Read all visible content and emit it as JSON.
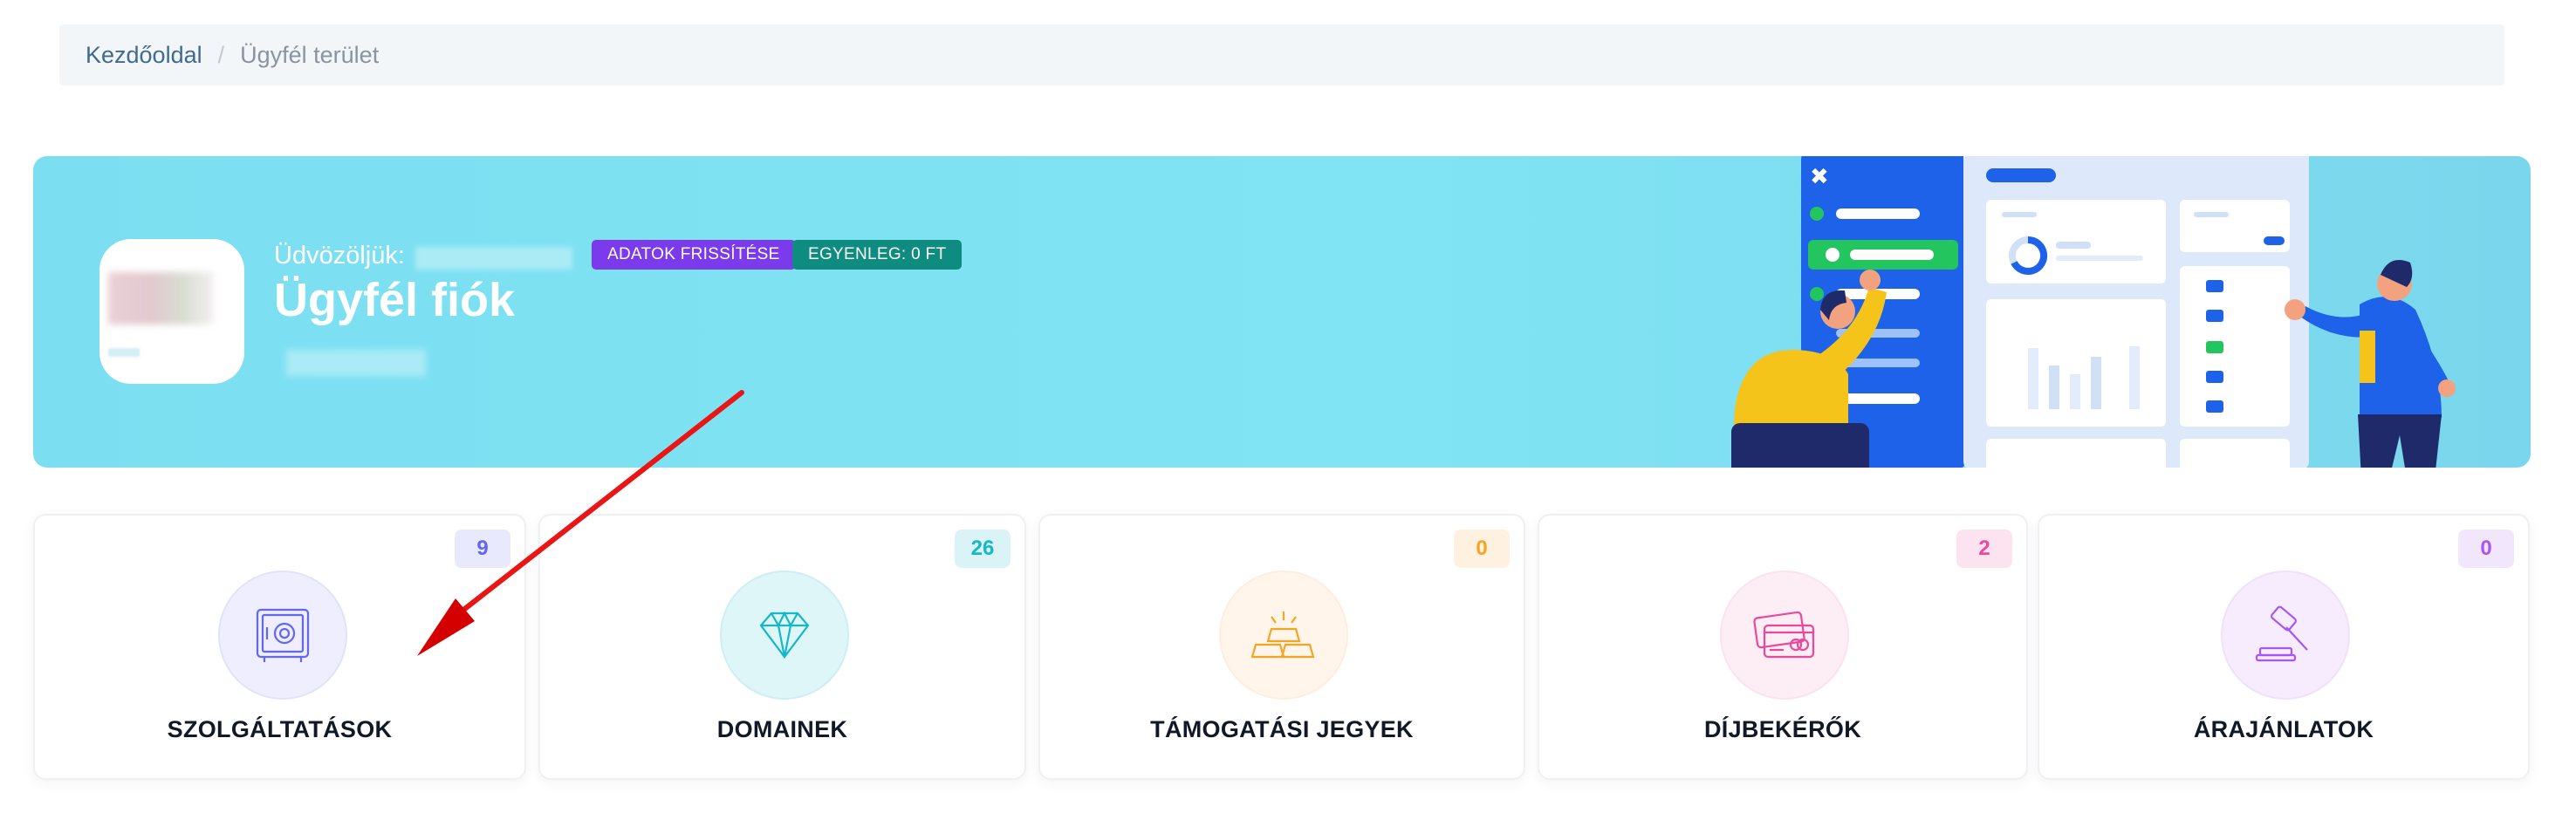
{
  "breadcrumb": {
    "home": "Kezdőoldal",
    "separator": "/",
    "current": "Ügyfél terület"
  },
  "hero": {
    "welcome": "Üdvözöljük:",
    "title": "Ügyfél fiók",
    "refresh_badge": "ADATOK FRISSÍTÉSE",
    "balance_badge": "EGYENLEG: 0 FT"
  },
  "cards": [
    {
      "label": "SZOLGÁLTATÁSOK",
      "count": "9",
      "icon": "safe-icon",
      "color": "#6366f1"
    },
    {
      "label": "DOMAINEK",
      "count": "26",
      "icon": "diamond-icon",
      "color": "#14b8c8"
    },
    {
      "label": "TÁMOGATÁSI JEGYEK",
      "count": "0",
      "icon": "gold-bars-icon",
      "color": "#f5a524"
    },
    {
      "label": "DÍJBEKÉRŐK",
      "count": "2",
      "icon": "credit-card-icon",
      "color": "#ec4899"
    },
    {
      "label": "ÁRAJÁNLATOK",
      "count": "0",
      "icon": "gavel-icon",
      "color": "#a855f7"
    }
  ],
  "colors": {
    "hero": "#7cdff1",
    "accent_purple": "#7c3aed",
    "accent_teal": "#0d8c7f",
    "annotation_arrow": "#e11d1d"
  }
}
